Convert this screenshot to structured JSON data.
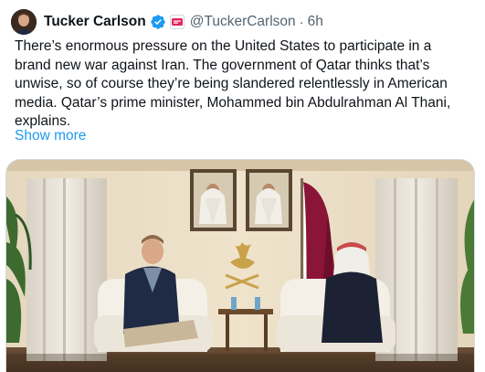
{
  "tweet": {
    "author_name": "Tucker Carlson",
    "handle": "@TuckerCarlson",
    "separator": "·",
    "time": "6h",
    "text_lines": [
      "There’s enormous pressure on the United States to participate in a",
      "brand new war against Iran. The government of Qatar thinks that’s",
      "unwise, so of course they’re being slandered relentlessly in American",
      "media. Qatar’s prime minister, Mohammed bin Abdulrahman Al Thani,",
      "explains."
    ],
    "show_more": "Show more",
    "icons": {
      "verified": "verified-badge-icon",
      "affiliate": "affiliate-badge-icon"
    }
  },
  "colors": {
    "link": "#1d9bf0",
    "verified": "#1d9bf0",
    "secondary_text": "#536471",
    "qatar_maroon": "#8a1538"
  }
}
